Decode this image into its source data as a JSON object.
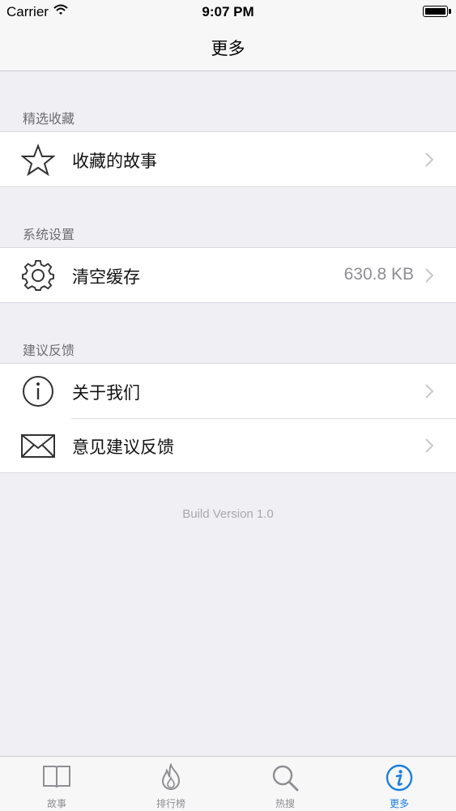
{
  "status_bar": {
    "carrier": "Carrier",
    "time": "9:07 PM"
  },
  "nav": {
    "title": "更多"
  },
  "sections": [
    {
      "header": "精选收藏",
      "rows": [
        {
          "icon": "star-icon",
          "label": "收藏的故事",
          "value": ""
        }
      ]
    },
    {
      "header": "系统设置",
      "rows": [
        {
          "icon": "gear-icon",
          "label": "清空缓存",
          "value": "630.8 KB"
        }
      ]
    },
    {
      "header": "建议反馈",
      "rows": [
        {
          "icon": "info-icon",
          "label": "关于我们",
          "value": ""
        },
        {
          "icon": "envelope-icon",
          "label": "意见建议反馈",
          "value": ""
        }
      ]
    }
  ],
  "build_version": "Build Version 1.0",
  "tabs": [
    {
      "label": "故事",
      "icon": "book-icon",
      "active": false
    },
    {
      "label": "排行榜",
      "icon": "flame-icon",
      "active": false
    },
    {
      "label": "热搜",
      "icon": "search-icon",
      "active": false
    },
    {
      "label": "更多",
      "icon": "info-icon",
      "active": true
    }
  ],
  "colors": {
    "accent": "#1a7fe0",
    "background": "#efeff4",
    "separator": "#d9d9dd"
  }
}
